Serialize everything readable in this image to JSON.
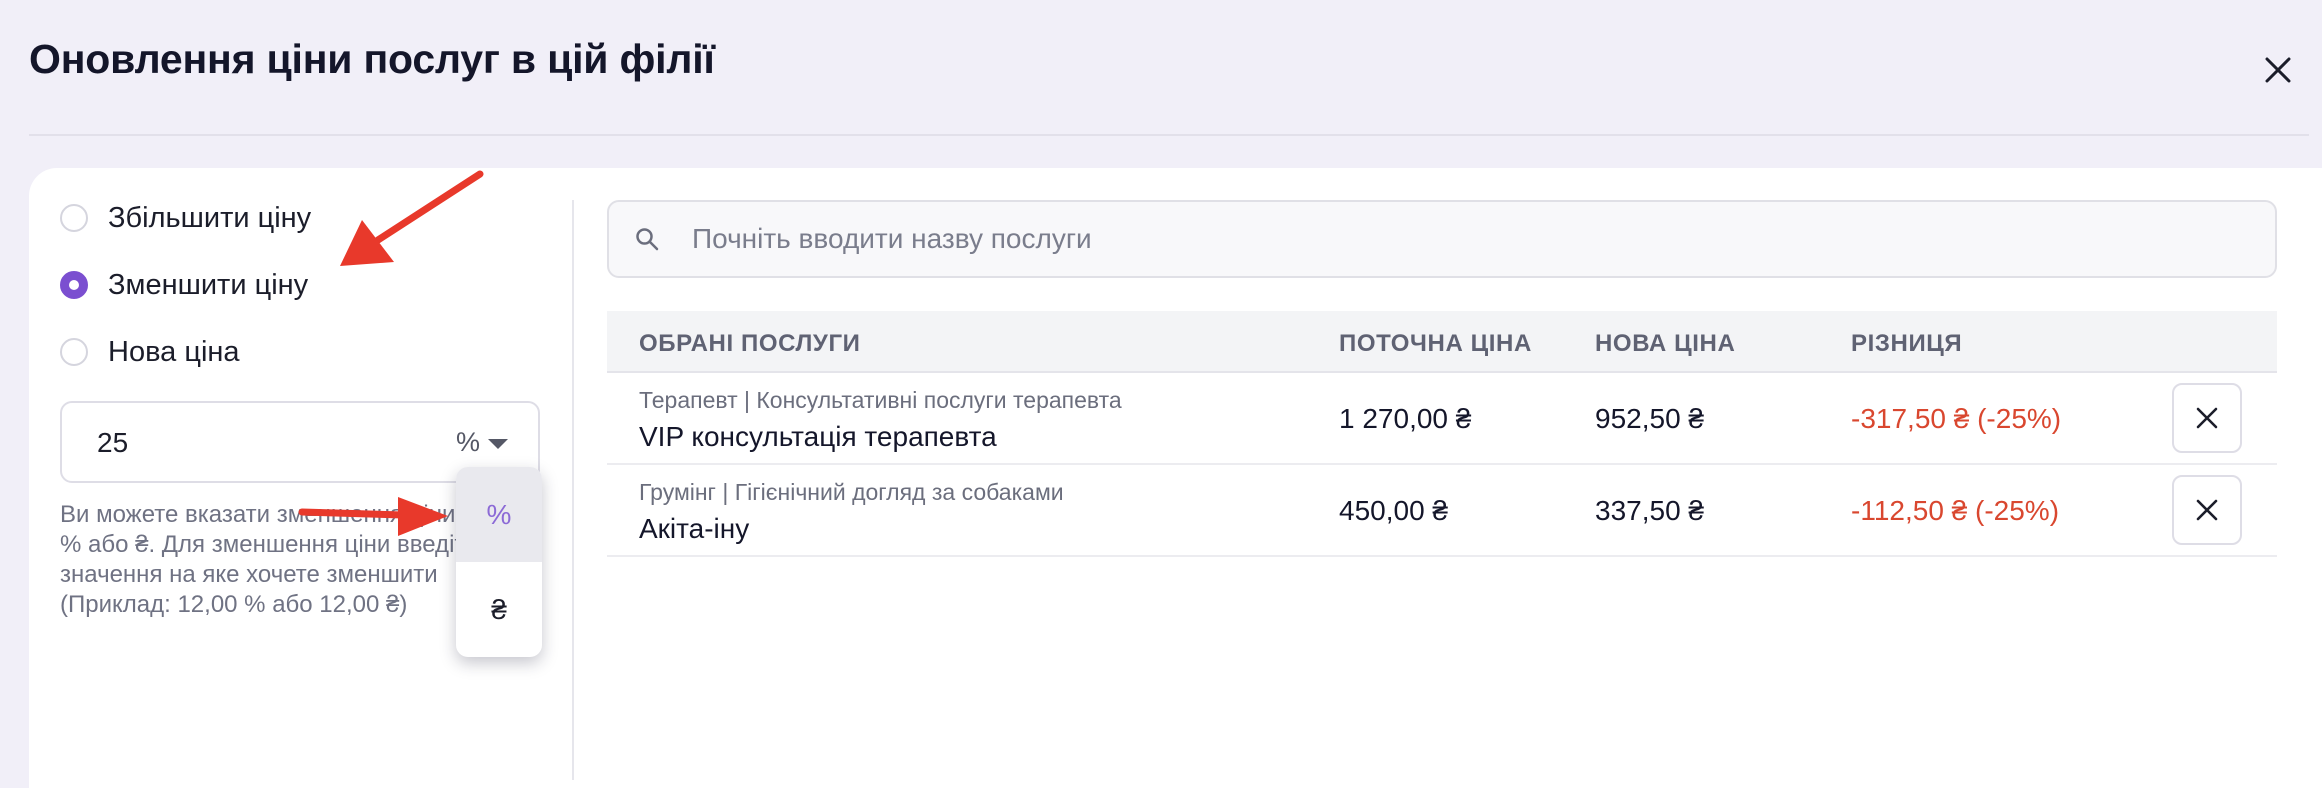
{
  "dialog": {
    "title": "Оновлення ціни послуг в цій філії"
  },
  "options": {
    "increase_label": "Збільшити ціну",
    "decrease_label": "Зменшити ціну",
    "new_price_label": "Нова ціна",
    "selected": "decrease"
  },
  "amount": {
    "value": "25",
    "unit": "%",
    "help_text": "Ви можете вказати зменшення ціни в % або ₴. Для зменшення ціни введіть значення на яке хочете зменшити (Приклад: 12,00 % або 12,00 ₴)"
  },
  "unit_dropdown": {
    "options": [
      "%",
      "₴"
    ],
    "selected": "%"
  },
  "search": {
    "placeholder": "Почніть вводити назву послуги"
  },
  "table": {
    "headers": {
      "services": "ОБРАНІ ПОСЛУГИ",
      "current_price": "ПОТОЧНА ЦІНА",
      "new_price": "НОВА ЦІНА",
      "difference": "РІЗНИЦЯ"
    },
    "rows": [
      {
        "category": "Терапевт | Консультативні послуги терапевта",
        "name": "VIP консультація терапевта",
        "current_price": "1 270,00 ₴",
        "new_price": "952,50 ₴",
        "difference": "-317,50 ₴ (-25%)"
      },
      {
        "category": "Грумінг | Гігієнічний догляд за собаками",
        "name": "Акіта-іну",
        "current_price": "450,00 ₴",
        "new_price": "337,50 ₴",
        "difference": "-112,50 ₴ (-25%)"
      }
    ]
  },
  "icons": {
    "close": "close-icon",
    "search": "search-icon",
    "remove": "close-icon"
  },
  "colors": {
    "accent": "#7b4fd0",
    "negative": "#d9472f",
    "annotation": "#e8392b"
  }
}
